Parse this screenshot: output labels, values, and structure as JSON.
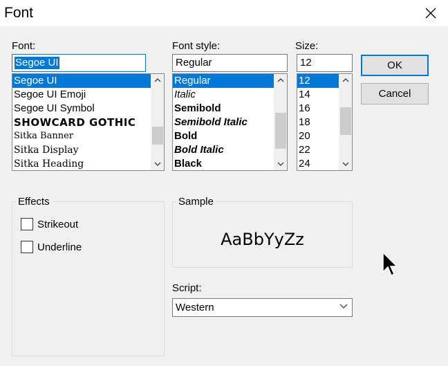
{
  "dialog": {
    "title": "Font"
  },
  "font": {
    "label": "Font:",
    "value": "Segoe UI",
    "items": [
      "Segoe UI",
      "Segoe UI Emoji",
      "Segoe UI Symbol",
      "SHOWCARD GOTHIC",
      "Sitka Banner",
      "Sitka Display",
      "Sitka Heading"
    ]
  },
  "style": {
    "label": "Font style:",
    "value": "Regular",
    "items": [
      "Regular",
      "Italic",
      "Semibold",
      "Semibold Italic",
      "Bold",
      "Bold Italic",
      "Black"
    ]
  },
  "size": {
    "label": "Size:",
    "value": "12",
    "items": [
      "12",
      "14",
      "16",
      "18",
      "20",
      "22",
      "24"
    ]
  },
  "buttons": {
    "ok": "OK",
    "cancel": "Cancel"
  },
  "effects": {
    "label": "Effects",
    "strikeout": "Strikeout",
    "underline": "Underline"
  },
  "sample": {
    "label": "Sample",
    "text": "AaBbYyZz"
  },
  "script": {
    "label": "Script:",
    "value": "Western"
  }
}
